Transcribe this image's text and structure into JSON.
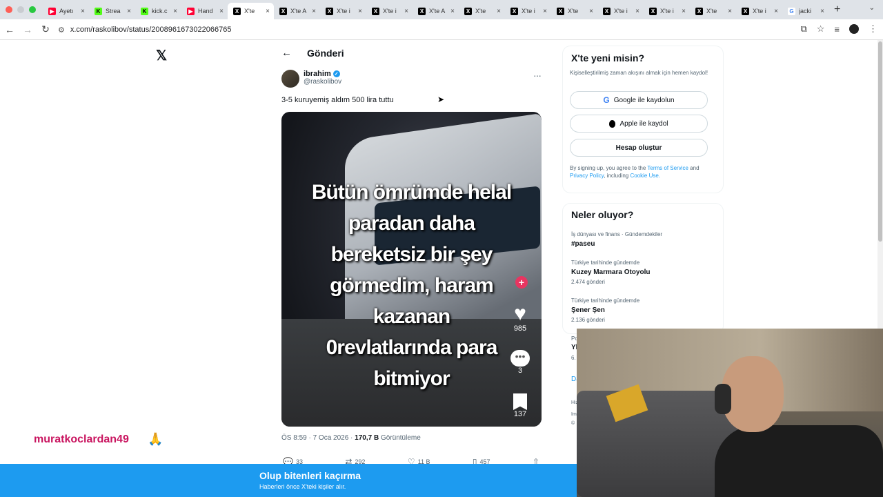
{
  "browser": {
    "tabs": [
      {
        "label": "Ayetı",
        "favicon": "youtube-icon"
      },
      {
        "label": "Strea",
        "favicon": "kick-icon"
      },
      {
        "label": "kick.c",
        "favicon": "kick-icon"
      },
      {
        "label": "Hand",
        "favicon": "youtube-icon"
      },
      {
        "label": "X'te",
        "favicon": "x-icon",
        "active": true
      },
      {
        "label": "X'te A",
        "favicon": "x-icon"
      },
      {
        "label": "X'te i",
        "favicon": "x-icon"
      },
      {
        "label": "X'te i",
        "favicon": "x-icon"
      },
      {
        "label": "X'te A",
        "favicon": "x-icon"
      },
      {
        "label": "X'te",
        "favicon": "x-icon"
      },
      {
        "label": "X'te i",
        "favicon": "x-icon"
      },
      {
        "label": "X'te",
        "favicon": "x-icon"
      },
      {
        "label": "X'te i",
        "favicon": "x-icon"
      },
      {
        "label": "X'te i",
        "favicon": "x-icon"
      },
      {
        "label": "X'te",
        "favicon": "x-icon"
      },
      {
        "label": "X'te i",
        "favicon": "x-icon"
      },
      {
        "label": "jacki",
        "favicon": "google-icon"
      }
    ],
    "url": "x.com/raskolibov/status/2008961673022066765"
  },
  "page": {
    "header_title": "Gönderi",
    "author_name": "ibrahim",
    "author_handle": "@raskolibov",
    "tweet_text": "3-5 kuruyemiş aldım 500 lira tuttu",
    "media_overlay_lines": [
      "Bütün ömrümde helal",
      "paradan daha",
      "bereketsiz bir şey",
      "görmedim, haram",
      "kazanan",
      "0revlatlarında para",
      "bitmiyor"
    ],
    "media_likes": "985",
    "media_comments": "3",
    "media_saves": "137",
    "meta_time": "ÖS 8:59 · 7 Oca 2026 · ",
    "meta_views": "170,7 B",
    "meta_views_label": " Görüntüleme",
    "actions": {
      "replies": "33",
      "reposts": "292",
      "likes": "11 B",
      "bookmarks": "457"
    }
  },
  "signup": {
    "title": "X'te yeni misin?",
    "subtitle": "Kişiselleştirilmiş zaman akışını almak için hemen kaydol!",
    "google_label": "Google ile kaydolun",
    "apple_label": "Apple ile kaydol",
    "create_label": "Hesap oluştur",
    "legal_pre": "By signing up, you agree to the ",
    "terms": "Terms of Service",
    "and": " and ",
    "privacy": "Privacy Policy",
    "including": ", including ",
    "cookie": "Cookie Use."
  },
  "trends": {
    "title": "Neler oluyor?",
    "items": [
      {
        "context": "İş dünyası ve finans · Gündemdekiler",
        "topic": "#paseu",
        "count": ""
      },
      {
        "context": "Türkiye tarihinde gündemde",
        "topic": "Kuzey Marmara Otoyolu",
        "count": "2.474 gönderi"
      },
      {
        "context": "Türkiye tarihinde gündemde",
        "topic": "Şener Şen",
        "count": "2.136 gönderi"
      }
    ],
    "partial": [
      "Po",
      "Yl",
      "6.",
      "Da",
      "Hiz",
      "Im",
      "©"
    ]
  },
  "banner": {
    "headline": "Olup bitenleri kaçırma",
    "sub": "Haberleri önce X'teki kişiler alır."
  },
  "overlay": {
    "watermark": "muratkoclardan49"
  },
  "colors": {
    "accent": "#1d9bf0",
    "watermark": "#c9145f",
    "tiktok_plus": "#e83561"
  }
}
